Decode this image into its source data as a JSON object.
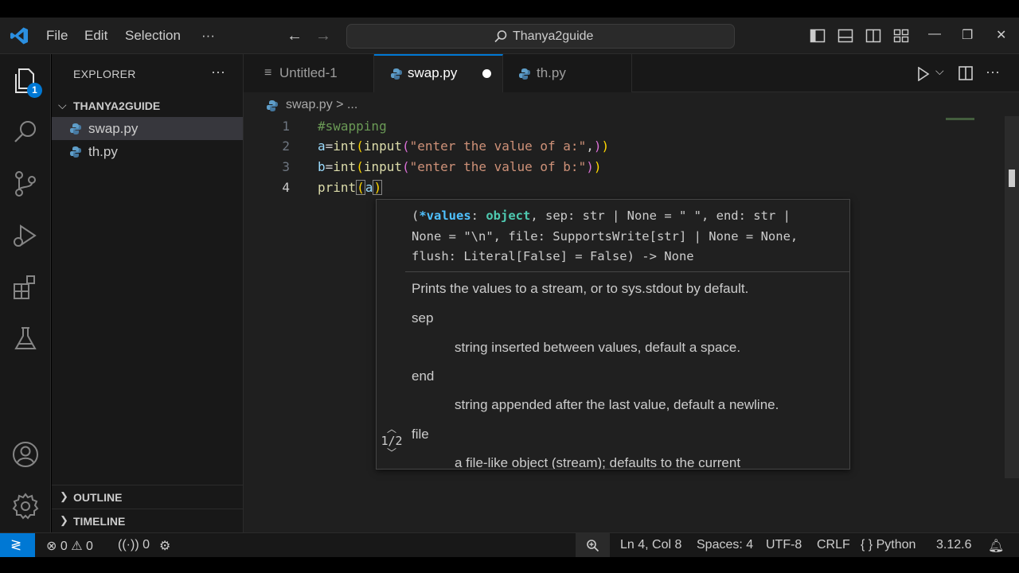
{
  "titlebar": {
    "menus": [
      "File",
      "Edit",
      "Selection",
      "···"
    ],
    "search_text": "Thanya2guide"
  },
  "sidebar": {
    "title": "EXPLORER",
    "more": "···",
    "folder": "THANYA2GUIDE",
    "files": [
      {
        "name": "swap.py",
        "selected": true
      },
      {
        "name": "th.py",
        "selected": false
      }
    ],
    "outline": "OUTLINE",
    "timeline": "TIMELINE",
    "badge": "1"
  },
  "tabs": [
    {
      "label": "Untitled-1",
      "active": false
    },
    {
      "label": "swap.py",
      "active": true,
      "dirty": true
    },
    {
      "label": "th.py",
      "active": false
    }
  ],
  "breadcrumb": {
    "file": "swap.py",
    "sep": " > ..."
  },
  "code": {
    "line_numbers": [
      "1",
      "2",
      "3",
      "4"
    ],
    "line1": "#swapping",
    "line2_var": "a",
    "line2_fn1": "int",
    "line2_fn2": "input",
    "line2_str": "\"enter the value of a:\"",
    "line3_var": "b",
    "line3_fn1": "int",
    "line3_fn2": "input",
    "line3_str": "\"enter the value of b:\"",
    "line4_fn": "print",
    "line4_arg": "a"
  },
  "hover": {
    "sig_param": "*values",
    "sig_type1": "object",
    "sig_rest1": ", sep: str | None = \" \", end: str |",
    "sig_line2": "None = \"\\n\", file: SupportsWrite[str] | None = None,",
    "sig_line3": "flush: Literal[False] = False) -> None",
    "doc_summary": "Prints the values to a stream, or to sys.stdout by default.",
    "sep_label": "sep",
    "sep_desc": "string inserted between values, default a space.",
    "end_label": "end",
    "end_desc": "string appended after the last value, default a newline.",
    "file_label": "file",
    "file_desc": "a file-like object (stream); defaults to the current",
    "pager": "1/2"
  },
  "statusbar": {
    "errors": "0",
    "warnings": "0",
    "ports": "0",
    "position": "Ln 4, Col 8",
    "spaces": "Spaces: 4",
    "encoding": "UTF-8",
    "eol": "CRLF",
    "language": "Python",
    "version": "3.12.6"
  },
  "colors": {
    "accent": "#0078d4",
    "editor_bg": "#1f1f1f",
    "sidebar_bg": "#181818"
  }
}
